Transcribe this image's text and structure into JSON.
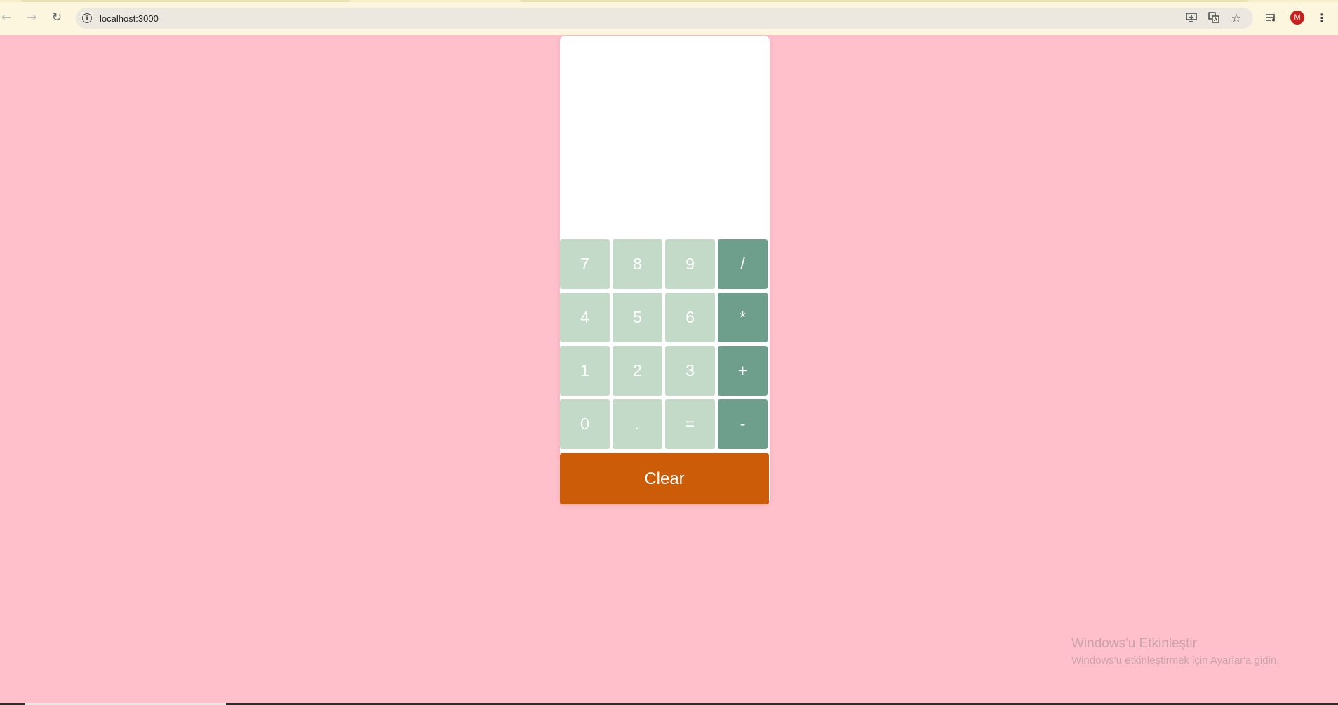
{
  "browser": {
    "url": "localhost:3000",
    "profile_initial": "M",
    "icons": {
      "back": "arrow-left-icon",
      "forward": "arrow-right-icon",
      "reload": "reload-icon",
      "site_info": "info-icon",
      "install": "install-app-icon",
      "translate": "translate-icon",
      "bookmark": "star-icon",
      "media": "media-controls-icon",
      "menu": "kebab-menu-icon"
    }
  },
  "calculator": {
    "display_value": "",
    "keys": [
      {
        "label": "7",
        "type": "digit"
      },
      {
        "label": "8",
        "type": "digit"
      },
      {
        "label": "9",
        "type": "digit"
      },
      {
        "label": "/",
        "type": "operator"
      },
      {
        "label": "4",
        "type": "digit"
      },
      {
        "label": "5",
        "type": "digit"
      },
      {
        "label": "6",
        "type": "digit"
      },
      {
        "label": "*",
        "type": "operator"
      },
      {
        "label": "1",
        "type": "digit"
      },
      {
        "label": "2",
        "type": "digit"
      },
      {
        "label": "3",
        "type": "digit"
      },
      {
        "label": "+",
        "type": "operator"
      },
      {
        "label": "0",
        "type": "digit"
      },
      {
        "label": ".",
        "type": "digit"
      },
      {
        "label": "=",
        "type": "digit"
      },
      {
        "label": "-",
        "type": "operator"
      }
    ],
    "clear_label": "Clear"
  },
  "colors": {
    "page_background": "#ffc0cb",
    "digit_key": "#c2dac7",
    "operator_key": "#6e9e8c",
    "clear_button": "#cc5c07"
  },
  "watermark": {
    "title": "Windows'u Etkinleştir",
    "subtitle": "Windows'u etkinleştirmek için Ayarlar'a gidin."
  }
}
